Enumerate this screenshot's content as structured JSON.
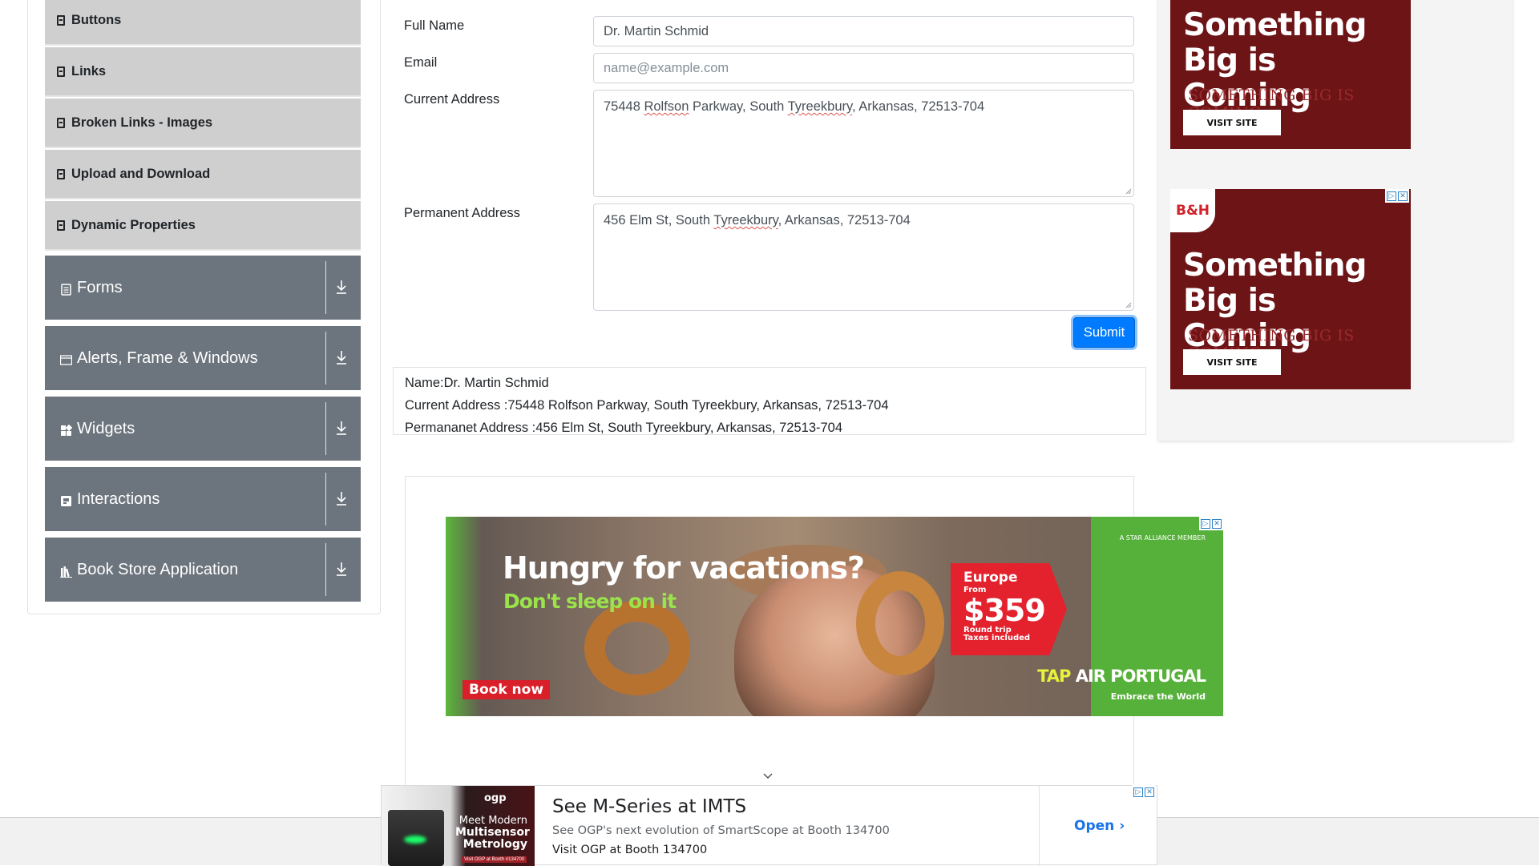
{
  "sidebar": {
    "sub_items": [
      {
        "label": "Buttons"
      },
      {
        "label": "Links"
      },
      {
        "label": "Broken Links - Images"
      },
      {
        "label": "Upload and Download"
      },
      {
        "label": "Dynamic Properties"
      }
    ],
    "groups": [
      {
        "label": "Forms",
        "icon": "form-icon"
      },
      {
        "label": "Alerts, Frame & Windows",
        "icon": "window-icon"
      },
      {
        "label": "Widgets",
        "icon": "widgets-icon"
      },
      {
        "label": "Interactions",
        "icon": "interactions-icon"
      },
      {
        "label": "Book Store Application",
        "icon": "books-icon"
      }
    ]
  },
  "form": {
    "full_name_label": "Full Name",
    "full_name_value": "Dr. Martin Schmid",
    "email_label": "Email",
    "email_placeholder": "name@example.com",
    "current_address_label": "Current Address",
    "current_address_parts": [
      "75448 ",
      "Rolfson",
      " Parkway, South ",
      "Tyreekbury",
      ", Arkansas, 72513-704"
    ],
    "permanent_address_label": "Permanent Address",
    "permanent_address_parts": [
      "456 Elm St, South ",
      "Tyreekbury",
      ", Arkansas, 72513-704"
    ],
    "submit_label": "Submit"
  },
  "output": {
    "name": "Name:Dr. Martin Schmid",
    "current_address": "Current Address :75448 Rolfson Parkway, South Tyreekbury, Arkansas, 72513-704",
    "permanent_address": "Permananet Address :456 Elm St, South Tyreekbury, Arkansas, 72513-704"
  },
  "ads": {
    "tap": {
      "headline": "Hungry for vacations?",
      "subline": "Don't sleep on it",
      "star_alliance": "A STAR ALLIANCE MEMBER",
      "price_dest": "Europe",
      "price_from": "From",
      "price": "$359",
      "price_note1": "Round trip",
      "price_note2": "Taxes included",
      "book_now": "Book now",
      "brand_tap": "TAP",
      "brand_rest": " AIR PORTUGAL",
      "tagline": "Embrace the World"
    },
    "bh": {
      "title_line1": "Something",
      "title_line2": "Big is Coming",
      "ghost_text": "SOMETHING BIG IS COMING",
      "visit": "VISIT SITE",
      "logo": "B&H"
    },
    "ogp": {
      "logo": "ogp",
      "img_line1": "Meet Modern",
      "img_line2": "Multisensor",
      "img_line3": "Metrology",
      "img_booth": "Visit OGP at Booth #134700",
      "title": "See M-Series at IMTS",
      "description": "See OGP's next evolution of SmartScope at Booth 134700",
      "line3": "Visit OGP at Booth 134700",
      "open": "Open"
    }
  },
  "colors": {
    "primary": "#007bff",
    "sidebar_group": "#6c757d",
    "sidebar_sub": "#cfcfcf",
    "bh_red": "#6d1417",
    "tap_green": "#56b13a"
  }
}
